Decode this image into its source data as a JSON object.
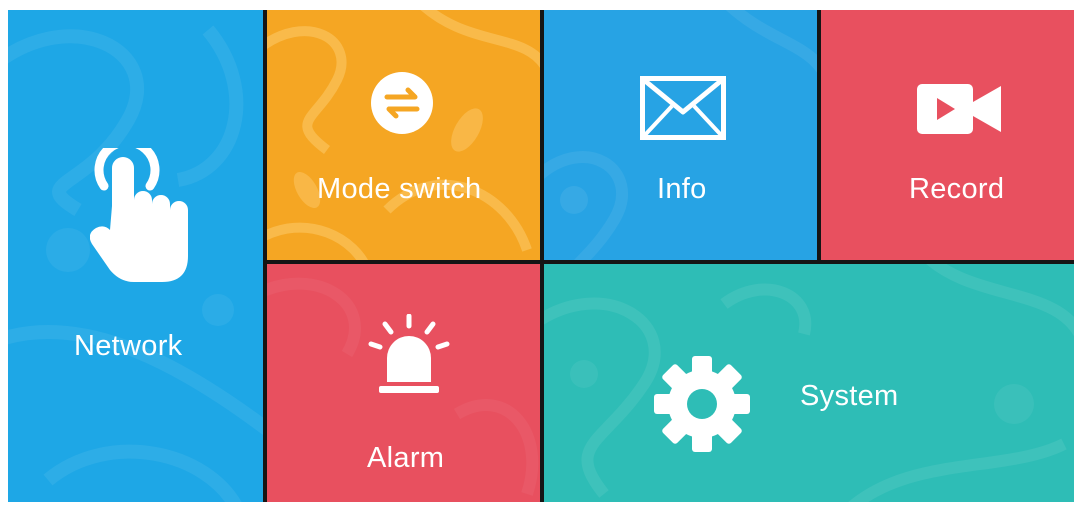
{
  "tiles": {
    "network": {
      "label": "Network",
      "icon": "touch-hand-icon",
      "color": "#1ea7e6"
    },
    "mode_switch": {
      "label": "Mode switch",
      "icon": "swap-arrows-icon",
      "color": "#f5a623"
    },
    "info": {
      "label": "Info",
      "icon": "envelope-icon",
      "color": "#27a3e4"
    },
    "record": {
      "label": "Record",
      "icon": "video-camera-icon",
      "color": "#e8505f"
    },
    "alarm": {
      "label": "Alarm",
      "icon": "siren-icon",
      "color": "#e8505f"
    },
    "system": {
      "label": "System",
      "icon": "gear-icon",
      "color": "#2ebdb6"
    }
  }
}
